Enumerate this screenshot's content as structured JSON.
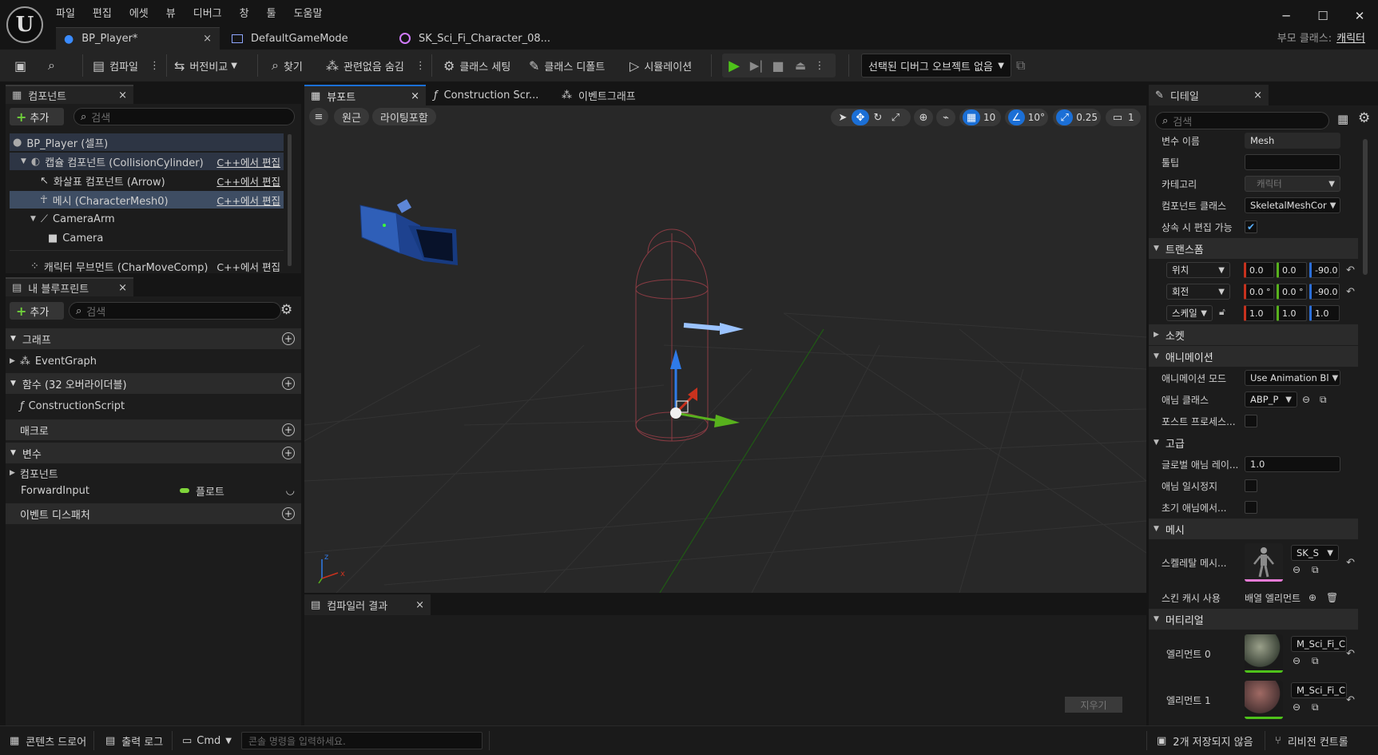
{
  "menu": [
    "파일",
    "편집",
    "에셋",
    "뷰",
    "디버그",
    "창",
    "툴",
    "도움말"
  ],
  "doc_tabs": [
    {
      "label": "BP_Player*",
      "close": "×"
    },
    {
      "label": "DefaultGameMode"
    },
    {
      "label": "SK_Sci_Fi_Character_08..."
    }
  ],
  "parent_class": {
    "label": "부모 클래스:",
    "value": "캐릭터"
  },
  "toolbar": {
    "compile": "컴파일",
    "diff": "버전비교",
    "find": "찾기",
    "hide_unrelated": "관련없음 숨김",
    "class_settings": "클래스 세팅",
    "class_defaults": "클래스 디폴트",
    "simulation": "시뮬레이션",
    "debug_object": "선택된 디버그 오브젝트 없음"
  },
  "components": {
    "tab": "컴포넌트",
    "add": "추가",
    "search_placeholder": "검색",
    "edit_cpp": "C++에서 편집",
    "items": [
      {
        "label": "BP_Player (셀프)"
      },
      {
        "label": "캡슐 컴포넌트 (CollisionCylinder)"
      },
      {
        "label": "화살표 컴포넌트 (Arrow)"
      },
      {
        "label": "메시 (CharacterMesh0)"
      },
      {
        "label": "CameraArm"
      },
      {
        "label": "Camera"
      },
      {
        "label": "캐릭터 무브먼트 (CharMoveComp)"
      }
    ]
  },
  "my_blueprint": {
    "tab": "내 블루프린트",
    "add": "추가",
    "search_placeholder": "검색",
    "graph": "그래프",
    "event_graph": "EventGraph",
    "functions": "함수 (32 오버라이더블)",
    "construction_script": "ConstructionScript",
    "macros": "매크로",
    "variables": "변수",
    "components": "컴포넌트",
    "forward_input": "ForwardInput",
    "float_type": "플로트",
    "event_dispatchers": "이벤트 디스패처"
  },
  "editor_tabs": {
    "viewport": "뷰포트",
    "construction": "Construction Scr...",
    "event_graph": "이벤트그래프"
  },
  "viewport": {
    "perspective": "원근",
    "lighting": "라이팅포함",
    "grid_snap": "10",
    "rot_snap": "10°",
    "scale_snap": "0.25",
    "camera_speed": "1"
  },
  "compiler": {
    "tab": "컴파일러 결과",
    "clear": "지우기"
  },
  "details": {
    "tab": "디테일",
    "search_placeholder": "검색",
    "variable_name_label": "변수 이름",
    "variable_name": "Mesh",
    "tooltip_label": "툴팁",
    "category_label": "카테고리",
    "category": "캐릭터",
    "component_class_label": "컴포넌트 클래스",
    "component_class": "SkeletalMeshCor",
    "editable_label": "상속 시 편집 가능",
    "transform": "트랜스폼",
    "location": "위치",
    "rotation": "회전",
    "scale": "스케일",
    "loc": [
      "0.0",
      "0.0",
      "-90.0"
    ],
    "rot": [
      "0.0 °",
      "0.0 °",
      "-90.0"
    ],
    "scl": [
      "1.0",
      "1.0",
      "1.0"
    ],
    "sockets": "소켓",
    "animation": "애니메이션",
    "anim_mode_label": "애니메이션 모드",
    "anim_mode": "Use Animation Bl",
    "anim_class_label": "애님 클래스",
    "anim_class": "ABP_P",
    "post_process_label": "포스트 프로세스...",
    "advanced": "고급",
    "global_anim_label": "글로벌 애님 레이...",
    "global_anim": "1.0",
    "pause_anims_label": "애님 일시정지",
    "initial_anim_label": "초기 애님에서...",
    "mesh": "메시",
    "skeletal_mesh_label": "스켈레탈 메시...",
    "skeletal_mesh": "SK_S",
    "skin_cache_label": "스킨 캐시 사용",
    "array_elements": "배열 엘리먼트",
    "materials": "머티리얼",
    "element0_label": "엘리먼트 0",
    "element0": "M_Sci_Fi_C",
    "element1_label": "엘리먼트 1",
    "element1": "M_Sci_Fi_C"
  },
  "statusbar": {
    "content_drawer": "콘텐츠 드로어",
    "output_log": "출력 로그",
    "cmd": "Cmd",
    "console_placeholder": "콘솔 명령을 입력하세요.",
    "unsaved": "2개 저장되지 않음",
    "revision": "리비전 컨트롤"
  },
  "colors": {
    "accent": "#1b6fd6",
    "play_green": "#4ec21a",
    "selection": "#3e4d63"
  }
}
